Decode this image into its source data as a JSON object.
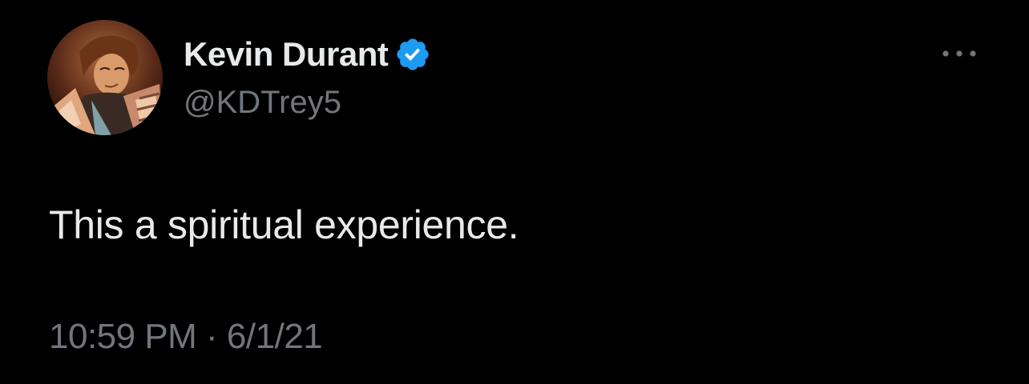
{
  "tweet": {
    "author": {
      "display_name": "Kevin Durant",
      "handle": "@KDTrey5",
      "verified": true,
      "avatar_icon": "profile-avatar"
    },
    "text": "This a spiritual experience.",
    "timestamp": "10:59 PM · 6/1/21",
    "more_icon": "more-options-icon"
  },
  "colors": {
    "background": "#000000",
    "primary_text": "#e7e9ea",
    "secondary_text": "#71767b",
    "verified_badge": "#1d9bf0"
  }
}
